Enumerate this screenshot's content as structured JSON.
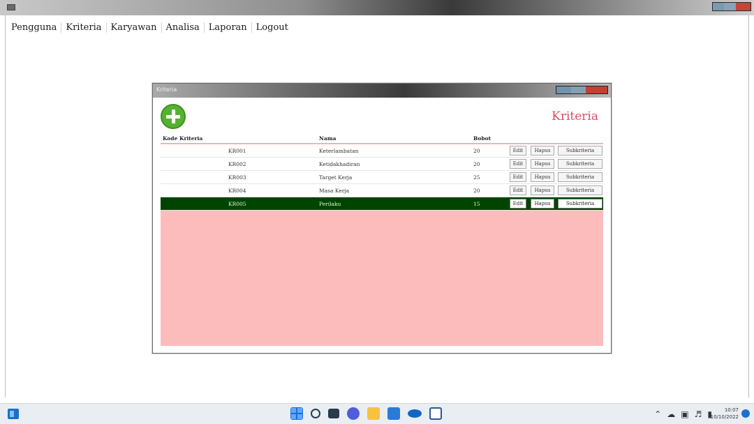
{
  "menu": {
    "items": [
      "Pengguna",
      "Kriteria",
      "Karyawan",
      "Analisa",
      "Laporan",
      "Logout"
    ]
  },
  "child_window": {
    "title": "Kriteria",
    "heading": "Kriteria"
  },
  "grid": {
    "columns": [
      "Kode Kriteria",
      "Nama",
      "Bobot"
    ],
    "rows": [
      {
        "kode": "KR001",
        "nama": "Keterlambatan",
        "bobot": "20"
      },
      {
        "kode": "KR002",
        "nama": "Ketidakhadiran",
        "bobot": "20"
      },
      {
        "kode": "KR003",
        "nama": "Target Kerja",
        "bobot": "25"
      },
      {
        "kode": "KR004",
        "nama": "Masa Kerja",
        "bobot": "20"
      },
      {
        "kode": "KR005",
        "nama": "Perilaku",
        "bobot": "15"
      }
    ],
    "actions": {
      "edit": "Edit",
      "hapus": "Hapus",
      "sub": "Subkriteria"
    },
    "selected_row": 4
  },
  "taskbar": {
    "time": "10:07",
    "date": "10/10/2022",
    "tray_icons": [
      "chevron-up-icon",
      "cloud-icon",
      "network-icon",
      "speaker-icon",
      "battery-icon"
    ]
  },
  "colors": {
    "accent_heading": "#e04a6a",
    "grid_background": "#fcbcbc",
    "selected_row": "#004400",
    "add_button": "#55b22f"
  }
}
